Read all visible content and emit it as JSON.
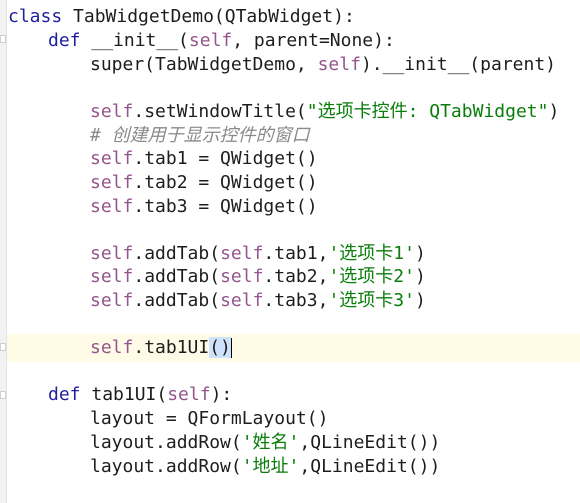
{
  "editor": {
    "line_class_kw": "class",
    "line_class_rest": " TabWidgetDemo(QTabWidget):",
    "line_def_kw": "def",
    "line_def_rest_1": " __init__(",
    "line_def_self": "self",
    "line_def_rest_2": ", parent=None):",
    "line_super_1": "super(TabWidgetDemo, ",
    "line_super_self": "self",
    "line_super_2": ").__init__(parent)",
    "line_settitle_self": "self",
    "line_settitle_1": ".setWindowTitle(",
    "line_settitle_str": "\"选项卡控件: QTabWidget\"",
    "line_settitle_2": ")",
    "line_comment": "# 创建用于显示控件的窗口",
    "line_tab1_self": "self",
    "line_tab1_rest": ".tab1 = QWidget()",
    "line_tab2_self": "self",
    "line_tab2_rest": ".tab2 = QWidget()",
    "line_tab3_self": "self",
    "line_tab3_rest": ".tab3 = QWidget()",
    "line_add1_self": "self",
    "line_add1_a": ".addTab(",
    "line_add1_self2": "self",
    "line_add1_b": ".tab1,",
    "line_add1_str": "'选项卡1'",
    "line_add1_c": ")",
    "line_add2_self": "self",
    "line_add2_a": ".addTab(",
    "line_add2_self2": "self",
    "line_add2_b": ".tab2,",
    "line_add2_str": "'选项卡2'",
    "line_add2_c": ")",
    "line_add3_self": "self",
    "line_add3_a": ".addTab(",
    "line_add3_self2": "self",
    "line_add3_b": ".tab3,",
    "line_add3_str": "'选项卡3'",
    "line_add3_c": ")",
    "line_call_self": "self",
    "line_call_rest": ".tab1UI",
    "line_call_parens": "()",
    "line_def2_kw": "def",
    "line_def2_rest_1": " tab1UI(",
    "line_def2_self": "self",
    "line_def2_rest_2": "):",
    "line_layout": "layout = QFormLayout()",
    "line_row1_a": "layout.addRow(",
    "line_row1_str": "'姓名'",
    "line_row1_b": ",QLineEdit())",
    "line_row2_a": "layout.addRow(",
    "line_row2_str": "'地址'",
    "line_row2_b": ",QLineEdit())"
  }
}
